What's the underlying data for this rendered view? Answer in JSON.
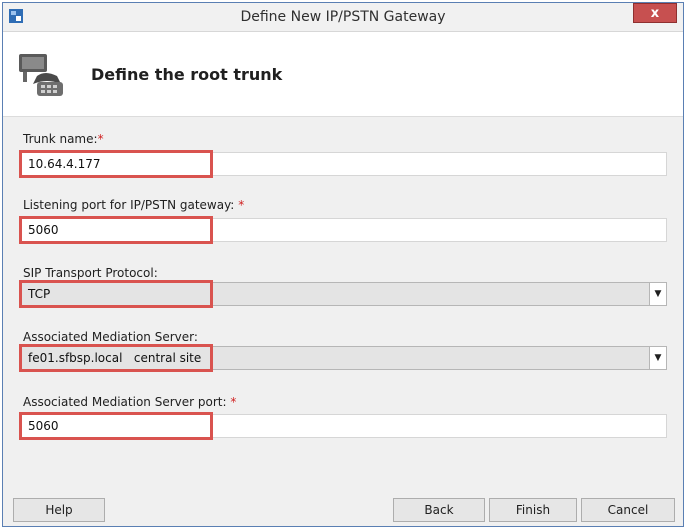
{
  "window": {
    "title": "Define New IP/PSTN Gateway",
    "close_glyph": "x"
  },
  "header": {
    "title": "Define the root trunk",
    "icon": "phone-gateway-icon"
  },
  "form": {
    "required_mark": "*",
    "trunk_name": {
      "label": "Trunk name:",
      "value": "10.64.4.177"
    },
    "listening_port": {
      "label": "Listening port for IP/PSTN gateway:",
      "value": "5060"
    },
    "sip_transport": {
      "label": "SIP Transport Protocol:",
      "value": "TCP"
    },
    "mediation_server": {
      "label": "Associated Mediation Server:",
      "value": "fe01.sfbsp.local   central site"
    },
    "mediation_port": {
      "label": "Associated Mediation Server port:",
      "value": "5060"
    }
  },
  "buttons": {
    "help": "Help",
    "back": "Back",
    "finish": "Finish",
    "cancel": "Cancel"
  },
  "colors": {
    "highlight": "#d9534f",
    "required": "#d02020",
    "close_button": "#c75050"
  }
}
